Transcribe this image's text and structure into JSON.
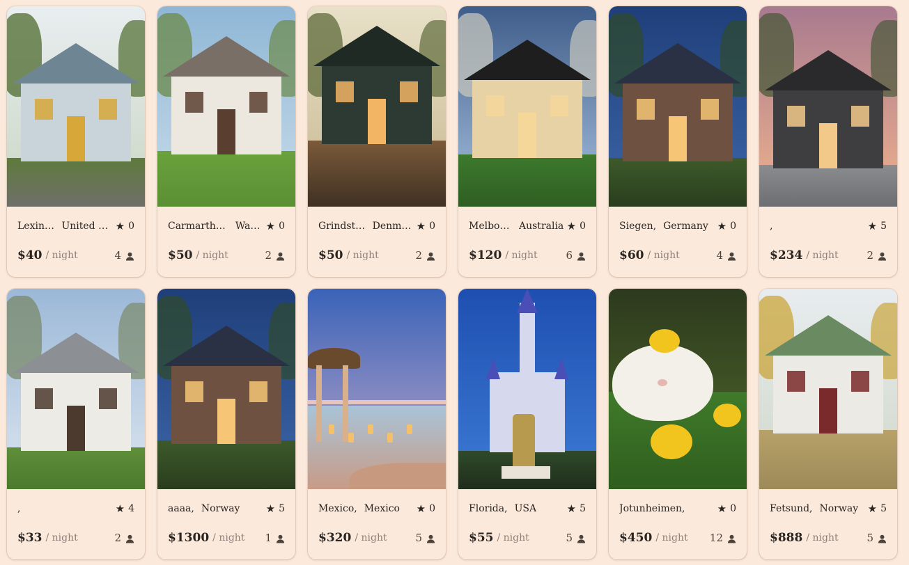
{
  "listings": [
    {
      "city": "Lexington",
      "country": "United States",
      "rating": "0",
      "price": "$40",
      "per": "/ night",
      "guests": "4",
      "scene": "farmhouse"
    },
    {
      "city": "Carmarthen,",
      "country": "Wales",
      "rating": "0",
      "price": "$50",
      "per": "/ night",
      "guests": "2",
      "scene": "cottage"
    },
    {
      "city": "Grindsted,",
      "country": "Denmark",
      "rating": "0",
      "price": "$50",
      "per": "/ night",
      "guests": "2",
      "scene": "cabin"
    },
    {
      "city": "Melbourne",
      "country": "Australia",
      "rating": "0",
      "price": "$120",
      "per": "/ night",
      "guests": "6",
      "scene": "modern"
    },
    {
      "city": "Siegen,",
      "country": "Germany",
      "rating": "0",
      "price": "$60",
      "per": "/ night",
      "guests": "4",
      "scene": "dusk-house"
    },
    {
      "city": ",",
      "country": "",
      "rating": "5",
      "price": "$234",
      "per": "/ night",
      "guests": "2",
      "scene": "villa"
    },
    {
      "city": ",",
      "country": "",
      "rating": "4",
      "price": "$33",
      "per": "/ night",
      "guests": "2",
      "scene": "barnhouse"
    },
    {
      "city": "aaaa,",
      "country": "Norway",
      "rating": "5",
      "price": "$1300",
      "per": "/ night",
      "guests": "1",
      "scene": "dusk-house"
    },
    {
      "city": "Mexico,",
      "country": "Mexico",
      "rating": "0",
      "price": "$320",
      "per": "/ night",
      "guests": "5",
      "scene": "resort"
    },
    {
      "city": "Florida,",
      "country": "USA",
      "rating": "5",
      "price": "$55",
      "per": "/ night",
      "guests": "5",
      "scene": "castle"
    },
    {
      "city": "Jotunheimen,",
      "country": "",
      "rating": "0",
      "price": "$450",
      "per": "/ night",
      "guests": "12",
      "scene": "cat"
    },
    {
      "city": "Fetsund,",
      "country": "Norway",
      "rating": "5",
      "price": "$888",
      "per": "/ night",
      "guests": "5",
      "scene": "white-house"
    }
  ],
  "icons": {
    "rating": "star-icon",
    "guests": "person-icon"
  },
  "colors": {
    "background": "#fbe9dc",
    "text": "#2b2521",
    "muted": "#8d8078"
  }
}
